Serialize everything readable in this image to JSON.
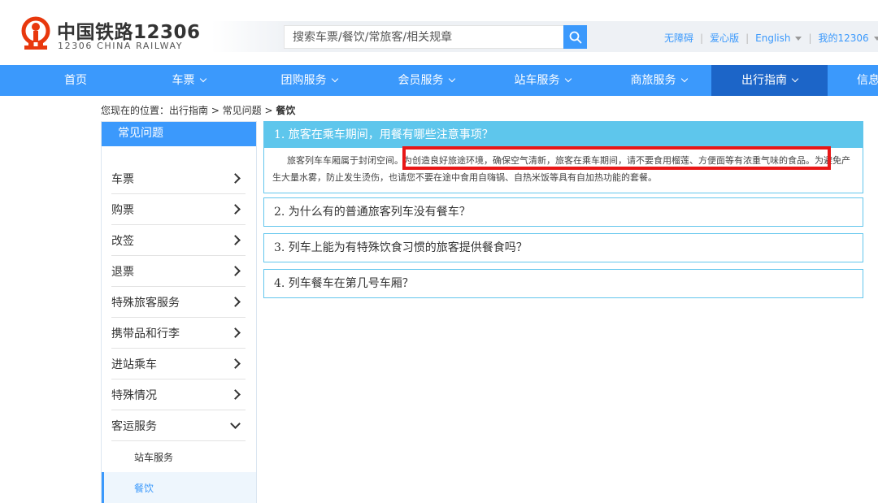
{
  "brand": {
    "title_cn": "中国铁路12306",
    "title_en": "12306 CHINA RAILWAY",
    "accent": "#3b99fc",
    "logo_color": "#e8380d"
  },
  "search": {
    "placeholder": "搜索车票/餐饮/常旅客/相关规章",
    "icon": "search-icon"
  },
  "toplinks": {
    "accessible": "无障碍",
    "caring": "爱心版",
    "english": "English",
    "my12306": "我的12306"
  },
  "nav": {
    "items": [
      {
        "label": "首页"
      },
      {
        "label": "车票"
      },
      {
        "label": "团购服务"
      },
      {
        "label": "会员服务"
      },
      {
        "label": "站车服务"
      },
      {
        "label": "商旅服务"
      },
      {
        "label": "出行指南"
      },
      {
        "label": "信息"
      }
    ],
    "active_index": 6
  },
  "breadcrumb": {
    "prefix": "您现在的位置：出行指南 > 常见问题 > ",
    "current": "餐饮"
  },
  "sidebar": {
    "header": "常见问题",
    "items": [
      {
        "label": "车票"
      },
      {
        "label": "购票"
      },
      {
        "label": "改签"
      },
      {
        "label": "退票"
      },
      {
        "label": "特殊旅客服务"
      },
      {
        "label": "携带品和行李"
      },
      {
        "label": "进站乘车"
      },
      {
        "label": "特殊情况"
      },
      {
        "label": "客运服务"
      }
    ],
    "subitems": [
      {
        "label": "站车服务"
      },
      {
        "label": "餐饮"
      }
    ]
  },
  "faq": [
    {
      "question": "1. 旅客在乘车期间，用餐有哪些注意事项？",
      "answer": "旅客列车车厢属于封闭空间。为创造良好旅途环境，确保空气清新，旅客在乘车期间，请不要食用榴莲、方便面等有浓重气味的食品。为避免产生大量水雾，防止发生烫伤，也请您不要在途中食用自嗨锅、自热米饭等具有自加热功能的套餐。"
    },
    {
      "question": "2. 为什么有的普通旅客列车没有餐车？"
    },
    {
      "question": "3. 列车上能为有特殊饮食习惯的旅客提供餐食吗？"
    },
    {
      "question": "4. 列车餐车在第几号车厢？"
    }
  ],
  "colors": {
    "nav_bg": "#3b99fc",
    "nav_active": "#1c65c8",
    "faq_border": "#63c6ed",
    "highlight": "#e81717"
  }
}
